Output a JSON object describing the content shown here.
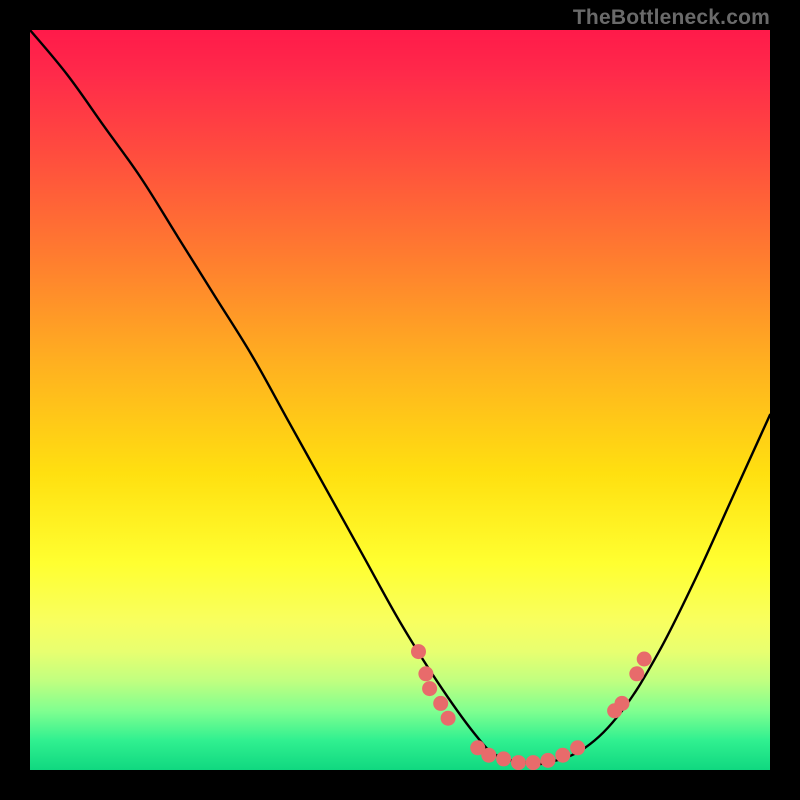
{
  "watermark": "TheBottleneck.com",
  "chart_data": {
    "type": "line",
    "title": "",
    "xlabel": "",
    "ylabel": "",
    "note": "Axes are not labeled in the image; x normalized 0–1 across plot width, y is bottleneck percentage where 0 = bottom (optimal) and 100 = top of plot.",
    "xlim": [
      0,
      1
    ],
    "ylim": [
      0,
      100
    ],
    "series": [
      {
        "name": "bottleneck-curve",
        "x": [
          0.0,
          0.05,
          0.1,
          0.15,
          0.2,
          0.25,
          0.3,
          0.35,
          0.4,
          0.45,
          0.5,
          0.55,
          0.6,
          0.63,
          0.67,
          0.7,
          0.75,
          0.8,
          0.85,
          0.9,
          0.95,
          1.0
        ],
        "y": [
          100,
          94,
          87,
          80,
          72,
          64,
          56,
          47,
          38,
          29,
          20,
          12,
          5,
          2,
          1,
          1,
          3,
          8,
          16,
          26,
          37,
          48
        ]
      }
    ],
    "markers": {
      "name": "similar-components",
      "color": "#e86b6b",
      "points": [
        {
          "x": 0.525,
          "y": 16
        },
        {
          "x": 0.535,
          "y": 13
        },
        {
          "x": 0.54,
          "y": 11
        },
        {
          "x": 0.555,
          "y": 9
        },
        {
          "x": 0.565,
          "y": 7
        },
        {
          "x": 0.605,
          "y": 3
        },
        {
          "x": 0.62,
          "y": 2
        },
        {
          "x": 0.64,
          "y": 1.5
        },
        {
          "x": 0.66,
          "y": 1
        },
        {
          "x": 0.68,
          "y": 1
        },
        {
          "x": 0.7,
          "y": 1.3
        },
        {
          "x": 0.72,
          "y": 2
        },
        {
          "x": 0.74,
          "y": 3
        },
        {
          "x": 0.79,
          "y": 8
        },
        {
          "x": 0.8,
          "y": 9
        },
        {
          "x": 0.82,
          "y": 13
        },
        {
          "x": 0.83,
          "y": 15
        }
      ]
    },
    "gradient_colors": {
      "top": "#ff1a4a",
      "mid": "#ffe010",
      "bottom": "#10d880"
    }
  }
}
